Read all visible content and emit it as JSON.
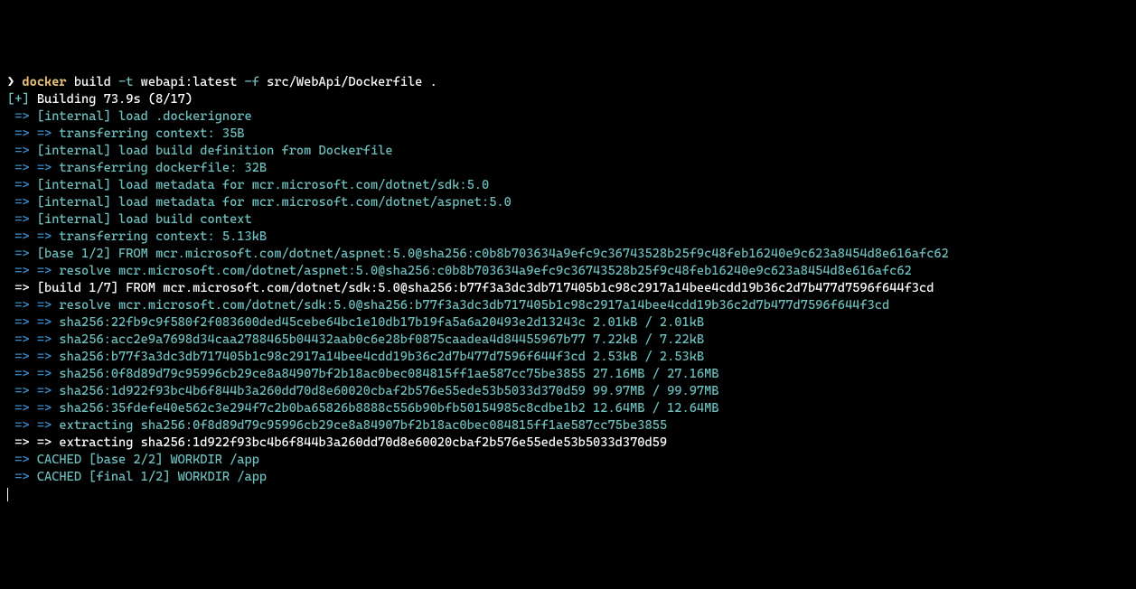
{
  "prompt": {
    "caret": "❯",
    "cmd": "docker",
    "sub": "build",
    "flag1": "-t",
    "arg1": "webapi:latest",
    "flag2": "-f",
    "arg2": "src/WebApi/Dockerfile",
    "dot": "."
  },
  "status": {
    "spinner": "[+]",
    "text": "Building 73.9s (8/17)"
  },
  "lines": [
    {
      "white": false,
      "double": false,
      "text": "[internal] load .dockerignore"
    },
    {
      "white": false,
      "double": true,
      "text": "transferring context: 35B"
    },
    {
      "white": false,
      "double": false,
      "text": "[internal] load build definition from Dockerfile"
    },
    {
      "white": false,
      "double": true,
      "text": "transferring dockerfile: 32B"
    },
    {
      "white": false,
      "double": false,
      "text": "[internal] load metadata for mcr.microsoft.com/dotnet/sdk:5.0"
    },
    {
      "white": false,
      "double": false,
      "text": "[internal] load metadata for mcr.microsoft.com/dotnet/aspnet:5.0"
    },
    {
      "white": false,
      "double": false,
      "text": "[internal] load build context"
    },
    {
      "white": false,
      "double": true,
      "text": "transferring context: 5.13kB"
    },
    {
      "white": false,
      "double": false,
      "text": "[base 1/2] FROM mcr.microsoft.com/dotnet/aspnet:5.0@sha256:c0b8b703634a9efc9c36743528b25f9c48feb16240e9c623a8454d8e616afc62"
    },
    {
      "white": false,
      "double": true,
      "text": "resolve mcr.microsoft.com/dotnet/aspnet:5.0@sha256:c0b8b703634a9efc9c36743528b25f9c48feb16240e9c623a8454d8e616afc62"
    },
    {
      "white": true,
      "double": false,
      "text": "[build 1/7] FROM mcr.microsoft.com/dotnet/sdk:5.0@sha256:b77f3a3dc3db717405b1c98c2917a14bee4cdd19b36c2d7b477d7596f644f3cd"
    },
    {
      "white": false,
      "double": true,
      "text": "resolve mcr.microsoft.com/dotnet/sdk:5.0@sha256:b77f3a3dc3db717405b1c98c2917a14bee4cdd19b36c2d7b477d7596f644f3cd"
    },
    {
      "white": false,
      "double": true,
      "text": "sha256:22fb9c9f580f2f083600ded45cebe64bc1e10db17b19fa5a6a20493e2d13243c 2.01kB / 2.01kB"
    },
    {
      "white": false,
      "double": true,
      "text": "sha256:acc2e9a7698d34caa2788465b04432aab0c6e28bf0875caadea4d84455967b77 7.22kB / 7.22kB"
    },
    {
      "white": false,
      "double": true,
      "text": "sha256:b77f3a3dc3db717405b1c98c2917a14bee4cdd19b36c2d7b477d7596f644f3cd 2.53kB / 2.53kB"
    },
    {
      "white": false,
      "double": true,
      "text": "sha256:0f8d89d79c95996cb29ce8a84907bf2b18ac0bec084815ff1ae587cc75be3855 27.16MB / 27.16MB"
    },
    {
      "white": false,
      "double": true,
      "text": "sha256:1d922f93bc4b6f844b3a260dd70d8e60020cbaf2b576e55ede53b5033d370d59 99.97MB / 99.97MB"
    },
    {
      "white": false,
      "double": true,
      "text": "sha256:35fdefe40e562c3e294f7c2b0ba65826b8888c556b90bfb50154985c8cdbe1b2 12.64MB / 12.64MB"
    },
    {
      "white": false,
      "double": true,
      "text": "extracting sha256:0f8d89d79c95996cb29ce8a84907bf2b18ac0bec084815ff1ae587cc75be3855"
    },
    {
      "white": true,
      "double": true,
      "text": "extracting sha256:1d922f93bc4b6f844b3a260dd70d8e60020cbaf2b576e55ede53b5033d370d59"
    },
    {
      "white": false,
      "double": false,
      "text": "CACHED [base 2/2] WORKDIR /app"
    },
    {
      "white": false,
      "double": false,
      "text": "CACHED [final 1/2] WORKDIR /app"
    }
  ]
}
